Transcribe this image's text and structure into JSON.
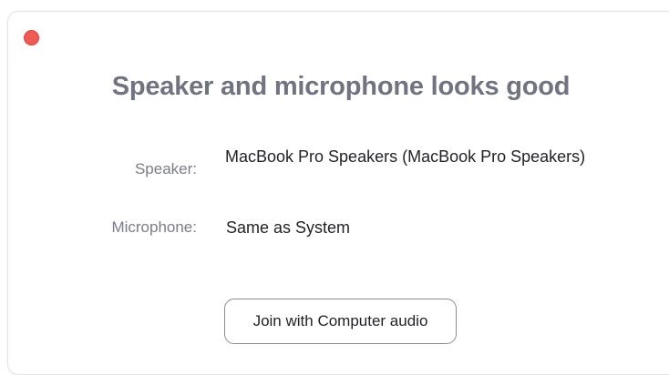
{
  "window": {
    "close_color": "#ee5b55"
  },
  "dialog": {
    "title": "Speaker and microphone looks good",
    "speaker": {
      "label": "Speaker:",
      "value": "MacBook Pro Speakers (MacBook Pro Speakers)"
    },
    "microphone": {
      "label": "Microphone:",
      "value": "Same as System"
    },
    "join_button_label": "Join with Computer audio"
  }
}
